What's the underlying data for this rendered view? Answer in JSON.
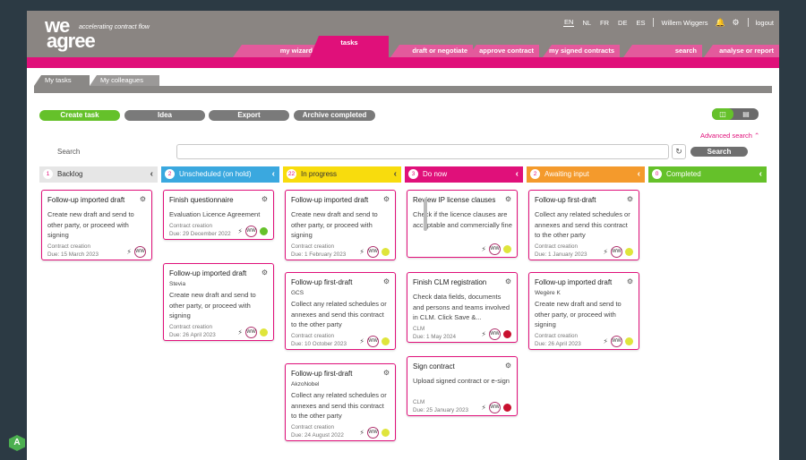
{
  "brand": {
    "logo_line1": "we",
    "logo_line2": "agree",
    "tagline": "accelerating contract flow"
  },
  "topbar": {
    "languages": [
      "EN",
      "NL",
      "FR",
      "DE",
      "ES"
    ],
    "active_language": "EN",
    "user": "Willem Wiggers",
    "logout": "logout"
  },
  "nav": {
    "tabs": [
      "my wizard",
      "tasks",
      "draft or negotiate",
      "approve contract",
      "my signed contracts",
      "search",
      "analyse or report"
    ],
    "active": "tasks"
  },
  "subtabs": {
    "items": [
      "My tasks",
      "My colleagues"
    ],
    "active": "My tasks"
  },
  "toolbar": {
    "create": "Create task",
    "idea": "Idea",
    "export": "Export",
    "archive": "Archive completed"
  },
  "search": {
    "label": "Search",
    "advanced": "Advanced search",
    "button": "Search",
    "placeholder": ""
  },
  "colors": {
    "pink": "#e0107a",
    "green": "#65c12a",
    "gray": "#8a8582"
  },
  "columns": [
    {
      "id": "backlog",
      "num": "1",
      "title": "Backlog",
      "color": "#e6e6e6",
      "text": "#333",
      "cards": [
        {
          "title": "Follow-up imported draft",
          "sub": "",
          "desc": "Create new draft and send to other party, or proceed with signing",
          "meta1": "Contract creation",
          "meta2": "Due: 15 March 2023",
          "initials": "WW",
          "dot": ""
        }
      ]
    },
    {
      "id": "unscheduled",
      "num": "2",
      "title": "Unscheduled (on hold)",
      "color": "#3aa8df",
      "text": "#fff",
      "cards": [
        {
          "title": "Finish questionnaire",
          "sub": "",
          "desc": "Evaluation Licence Agreement",
          "meta1": "Contract creation",
          "meta2": "Due: 29 December 2022",
          "initials": "WW",
          "dot": "#65c12a"
        },
        {
          "title": "Follow-up imported draft",
          "sub": "Stevia",
          "desc": "Create new draft and send to other party, or proceed with signing",
          "meta1": "Contract creation",
          "meta2": "Due: 26 April 2023",
          "initials": "WW",
          "dot": "#dfe53b"
        }
      ]
    },
    {
      "id": "inprogress",
      "num": "22",
      "title": "In progress",
      "color": "#f8dc0d",
      "text": "#333",
      "cards": [
        {
          "title": "Follow-up imported draft",
          "sub": "",
          "desc": "Create new draft and send to other party, or proceed with signing",
          "meta1": "Contract creation",
          "meta2": "Due: 1 February 2023",
          "initials": "WW",
          "dot": "#dfe53b"
        },
        {
          "title": "Follow-up first-draft",
          "sub": "GCS",
          "desc": "Collect any related schedules or annexes and send this contract to the other party",
          "meta1": "Contract creation",
          "meta2": "Due: 10 October 2023",
          "initials": "WW",
          "dot": "#dfe53b"
        },
        {
          "title": "Follow-up first-draft",
          "sub": "AkzoNobel",
          "desc": "Collect any related schedules or annexes and send this contract to the other party",
          "meta1": "Contract creation",
          "meta2": "Due: 24 August 2022",
          "initials": "WW",
          "dot": "#dfe53b"
        }
      ]
    },
    {
      "id": "donow",
      "num": "3",
      "title": "Do now",
      "color": "#e0107a",
      "text": "#fff",
      "cards": [
        {
          "title": "Review IP license clauses",
          "sub": "",
          "desc": "Check if the licence clauses are acceptable and commercially fine",
          "meta1": "",
          "meta2": "",
          "initials": "WW",
          "dot": "#dfe53b"
        },
        {
          "title": "Finish CLM registration",
          "sub": "",
          "desc": "Check data fields, documents and persons and teams involved in CLM. Click Save &...",
          "meta1": "CLM",
          "meta2": "Due: 1 May 2024",
          "initials": "WW",
          "dot": "#c8102e"
        },
        {
          "title": "Sign contract",
          "sub": "",
          "desc": "Upload signed contract or e-sign",
          "meta1": "CLM",
          "meta2": "Due: 25 January 2023",
          "initials": "WW",
          "dot": "#c8102e"
        }
      ]
    },
    {
      "id": "awaiting",
      "num": "2",
      "title": "Awaiting input",
      "color": "#f49a2c",
      "text": "#fff",
      "cards": [
        {
          "title": "Follow-up first-draft",
          "sub": "",
          "desc": "Collect any related schedules or annexes and send this contract to the other party",
          "meta1": "Contract creation",
          "meta2": "Due: 1 January 2023",
          "initials": "WW",
          "dot": "#dfe53b"
        },
        {
          "title": "Follow-up imported draft",
          "sub": "Wegère K",
          "desc": "Create new draft and send to other party, or proceed with signing",
          "meta1": "Contract creation",
          "meta2": "Due: 26 April 2023",
          "initials": "WW",
          "dot": "#dfe53b"
        }
      ]
    },
    {
      "id": "completed",
      "num": "0",
      "title": "Completed",
      "color": "#65c12a",
      "text": "#fff",
      "cards": []
    }
  ],
  "corner_badge": "A"
}
